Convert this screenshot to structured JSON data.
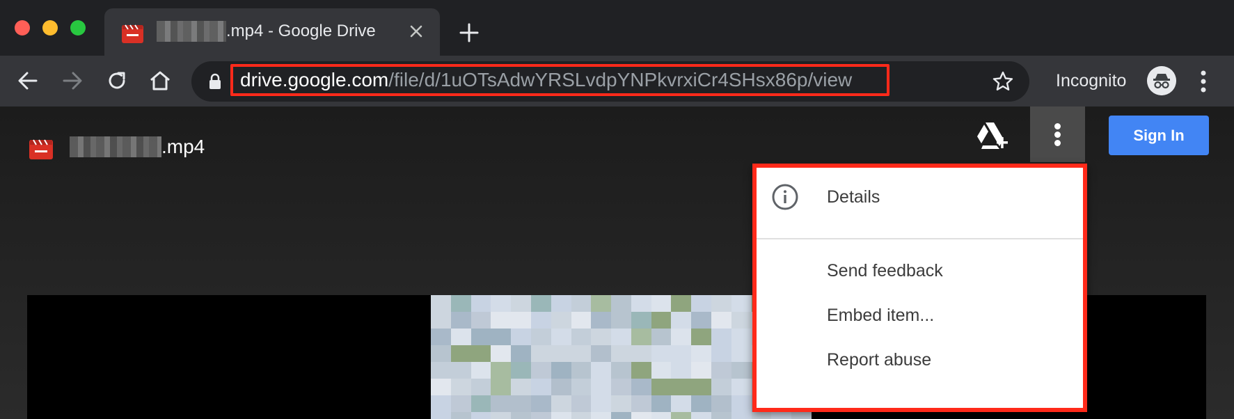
{
  "tab": {
    "title_suffix": ".mp4 - Google Drive",
    "close_icon": "close-icon",
    "new_tab_icon": "plus-icon"
  },
  "toolbar": {
    "url_host": "drive.google.com",
    "url_path": "/file/d/1uOTsAdwYRSLvdpYNPkvrxiCr4SHsx86p/view",
    "incognito_label": "Incognito"
  },
  "viewer": {
    "file_name_suffix": ".mp4",
    "sign_in_label": "Sign In"
  },
  "menu": {
    "items": [
      {
        "label": "Details",
        "icon": "info-icon"
      },
      {
        "label": "Send feedback"
      },
      {
        "label": "Embed item..."
      },
      {
        "label": "Report abuse"
      }
    ]
  },
  "colors": {
    "highlight": "#ff2a1a",
    "sign_in_blue": "#4285f4"
  }
}
